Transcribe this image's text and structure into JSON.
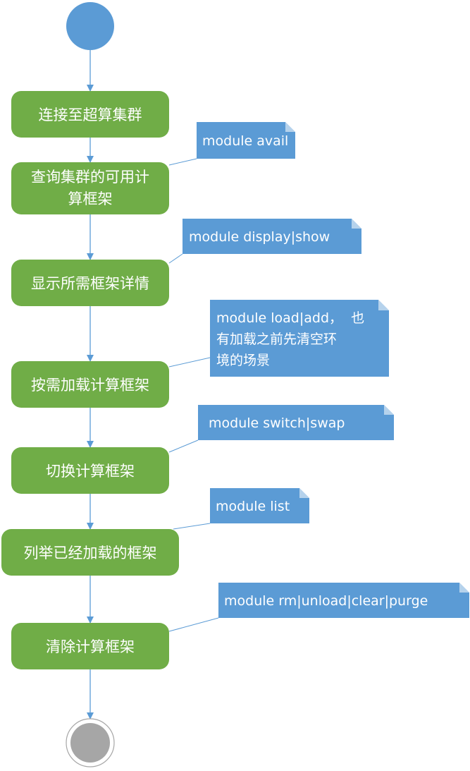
{
  "colors": {
    "step_fill": "#70ad47",
    "step_text": "#ffffff",
    "note_fill": "#5b9bd5",
    "note_text": "#ffffff",
    "arrow": "#5b9bd5",
    "start_node": "#5b9bd5",
    "end_node": "#a6a6a6"
  },
  "start_node": {
    "icon": "start-node-filled-circle"
  },
  "end_node": {
    "icon": "end-node-bullseye-circle"
  },
  "steps": [
    {
      "lines": [
        "连接至超算集群"
      ]
    },
    {
      "lines": [
        "查询集群的可用计",
        "算框架"
      ]
    },
    {
      "lines": [
        "显示所需框架详情"
      ]
    },
    {
      "lines": [
        "按需加载计算框架"
      ]
    },
    {
      "lines": [
        "切换计算框架"
      ]
    },
    {
      "lines": [
        "列举已经加载的框架"
      ]
    },
    {
      "lines": [
        "清除计算框架"
      ]
    }
  ],
  "notes": [
    {
      "lines": [
        "module avail"
      ]
    },
    {
      "lines": [
        "module display|show"
      ]
    },
    {
      "lines": [
        "module load|add，  也",
        "有加载之前先清空环",
        "境的场景"
      ]
    },
    {
      "lines": [
        "module switch|swap"
      ]
    },
    {
      "lines": [
        "module list"
      ]
    },
    {
      "lines": [
        "module rm|unload|clear|purge"
      ]
    }
  ]
}
